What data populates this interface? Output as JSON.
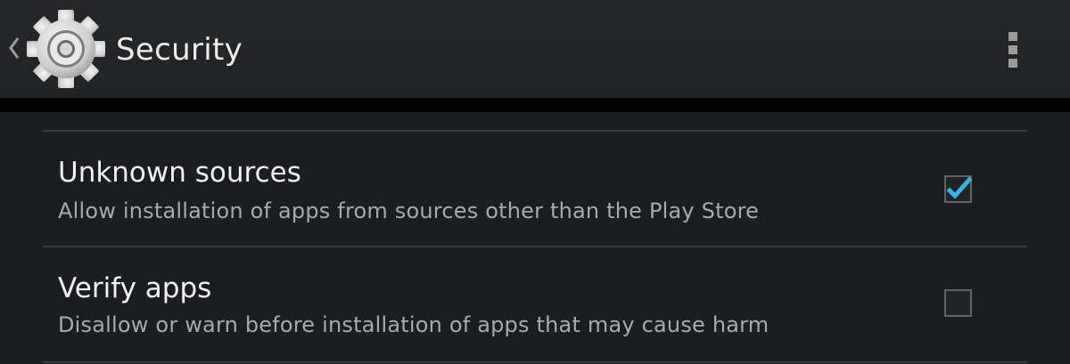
{
  "action_bar": {
    "title": "Security",
    "app_icon": "gear-icon",
    "up_icon": "chevron-left-icon",
    "overflow_icon": "overflow-menu-icon"
  },
  "preferences": [
    {
      "title": "Unknown sources",
      "summary": "Allow installation of apps from sources other than the Play Store",
      "checked": true
    },
    {
      "title": "Verify apps",
      "summary": "Disallow or warn before installation of apps that may cause harm",
      "checked": false
    }
  ],
  "colors": {
    "accent": "#33b5e5",
    "background": "#1b1d20",
    "action_bar": "#242527",
    "primary_text": "#f2f2f2",
    "secondary_text": "#a7a9ab"
  }
}
